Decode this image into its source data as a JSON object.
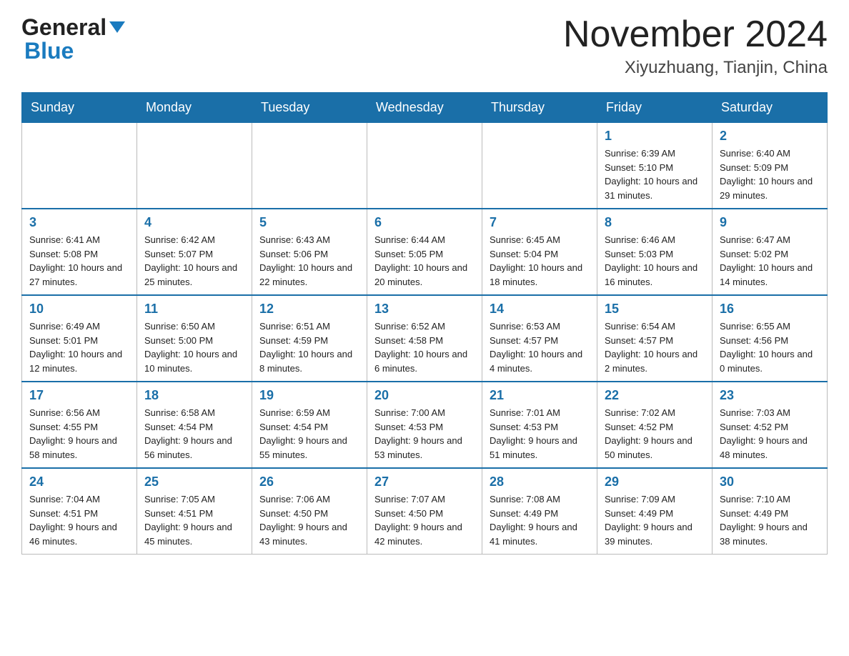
{
  "header": {
    "logo_line1": "General",
    "logo_line2": "Blue",
    "month_title": "November 2024",
    "location": "Xiyuzhuang, Tianjin, China"
  },
  "weekdays": [
    "Sunday",
    "Monday",
    "Tuesday",
    "Wednesday",
    "Thursday",
    "Friday",
    "Saturday"
  ],
  "weeks": [
    [
      {
        "day": "",
        "info": ""
      },
      {
        "day": "",
        "info": ""
      },
      {
        "day": "",
        "info": ""
      },
      {
        "day": "",
        "info": ""
      },
      {
        "day": "",
        "info": ""
      },
      {
        "day": "1",
        "info": "Sunrise: 6:39 AM\nSunset: 5:10 PM\nDaylight: 10 hours and 31 minutes."
      },
      {
        "day": "2",
        "info": "Sunrise: 6:40 AM\nSunset: 5:09 PM\nDaylight: 10 hours and 29 minutes."
      }
    ],
    [
      {
        "day": "3",
        "info": "Sunrise: 6:41 AM\nSunset: 5:08 PM\nDaylight: 10 hours and 27 minutes."
      },
      {
        "day": "4",
        "info": "Sunrise: 6:42 AM\nSunset: 5:07 PM\nDaylight: 10 hours and 25 minutes."
      },
      {
        "day": "5",
        "info": "Sunrise: 6:43 AM\nSunset: 5:06 PM\nDaylight: 10 hours and 22 minutes."
      },
      {
        "day": "6",
        "info": "Sunrise: 6:44 AM\nSunset: 5:05 PM\nDaylight: 10 hours and 20 minutes."
      },
      {
        "day": "7",
        "info": "Sunrise: 6:45 AM\nSunset: 5:04 PM\nDaylight: 10 hours and 18 minutes."
      },
      {
        "day": "8",
        "info": "Sunrise: 6:46 AM\nSunset: 5:03 PM\nDaylight: 10 hours and 16 minutes."
      },
      {
        "day": "9",
        "info": "Sunrise: 6:47 AM\nSunset: 5:02 PM\nDaylight: 10 hours and 14 minutes."
      }
    ],
    [
      {
        "day": "10",
        "info": "Sunrise: 6:49 AM\nSunset: 5:01 PM\nDaylight: 10 hours and 12 minutes."
      },
      {
        "day": "11",
        "info": "Sunrise: 6:50 AM\nSunset: 5:00 PM\nDaylight: 10 hours and 10 minutes."
      },
      {
        "day": "12",
        "info": "Sunrise: 6:51 AM\nSunset: 4:59 PM\nDaylight: 10 hours and 8 minutes."
      },
      {
        "day": "13",
        "info": "Sunrise: 6:52 AM\nSunset: 4:58 PM\nDaylight: 10 hours and 6 minutes."
      },
      {
        "day": "14",
        "info": "Sunrise: 6:53 AM\nSunset: 4:57 PM\nDaylight: 10 hours and 4 minutes."
      },
      {
        "day": "15",
        "info": "Sunrise: 6:54 AM\nSunset: 4:57 PM\nDaylight: 10 hours and 2 minutes."
      },
      {
        "day": "16",
        "info": "Sunrise: 6:55 AM\nSunset: 4:56 PM\nDaylight: 10 hours and 0 minutes."
      }
    ],
    [
      {
        "day": "17",
        "info": "Sunrise: 6:56 AM\nSunset: 4:55 PM\nDaylight: 9 hours and 58 minutes."
      },
      {
        "day": "18",
        "info": "Sunrise: 6:58 AM\nSunset: 4:54 PM\nDaylight: 9 hours and 56 minutes."
      },
      {
        "day": "19",
        "info": "Sunrise: 6:59 AM\nSunset: 4:54 PM\nDaylight: 9 hours and 55 minutes."
      },
      {
        "day": "20",
        "info": "Sunrise: 7:00 AM\nSunset: 4:53 PM\nDaylight: 9 hours and 53 minutes."
      },
      {
        "day": "21",
        "info": "Sunrise: 7:01 AM\nSunset: 4:53 PM\nDaylight: 9 hours and 51 minutes."
      },
      {
        "day": "22",
        "info": "Sunrise: 7:02 AM\nSunset: 4:52 PM\nDaylight: 9 hours and 50 minutes."
      },
      {
        "day": "23",
        "info": "Sunrise: 7:03 AM\nSunset: 4:52 PM\nDaylight: 9 hours and 48 minutes."
      }
    ],
    [
      {
        "day": "24",
        "info": "Sunrise: 7:04 AM\nSunset: 4:51 PM\nDaylight: 9 hours and 46 minutes."
      },
      {
        "day": "25",
        "info": "Sunrise: 7:05 AM\nSunset: 4:51 PM\nDaylight: 9 hours and 45 minutes."
      },
      {
        "day": "26",
        "info": "Sunrise: 7:06 AM\nSunset: 4:50 PM\nDaylight: 9 hours and 43 minutes."
      },
      {
        "day": "27",
        "info": "Sunrise: 7:07 AM\nSunset: 4:50 PM\nDaylight: 9 hours and 42 minutes."
      },
      {
        "day": "28",
        "info": "Sunrise: 7:08 AM\nSunset: 4:49 PM\nDaylight: 9 hours and 41 minutes."
      },
      {
        "day": "29",
        "info": "Sunrise: 7:09 AM\nSunset: 4:49 PM\nDaylight: 9 hours and 39 minutes."
      },
      {
        "day": "30",
        "info": "Sunrise: 7:10 AM\nSunset: 4:49 PM\nDaylight: 9 hours and 38 minutes."
      }
    ]
  ]
}
